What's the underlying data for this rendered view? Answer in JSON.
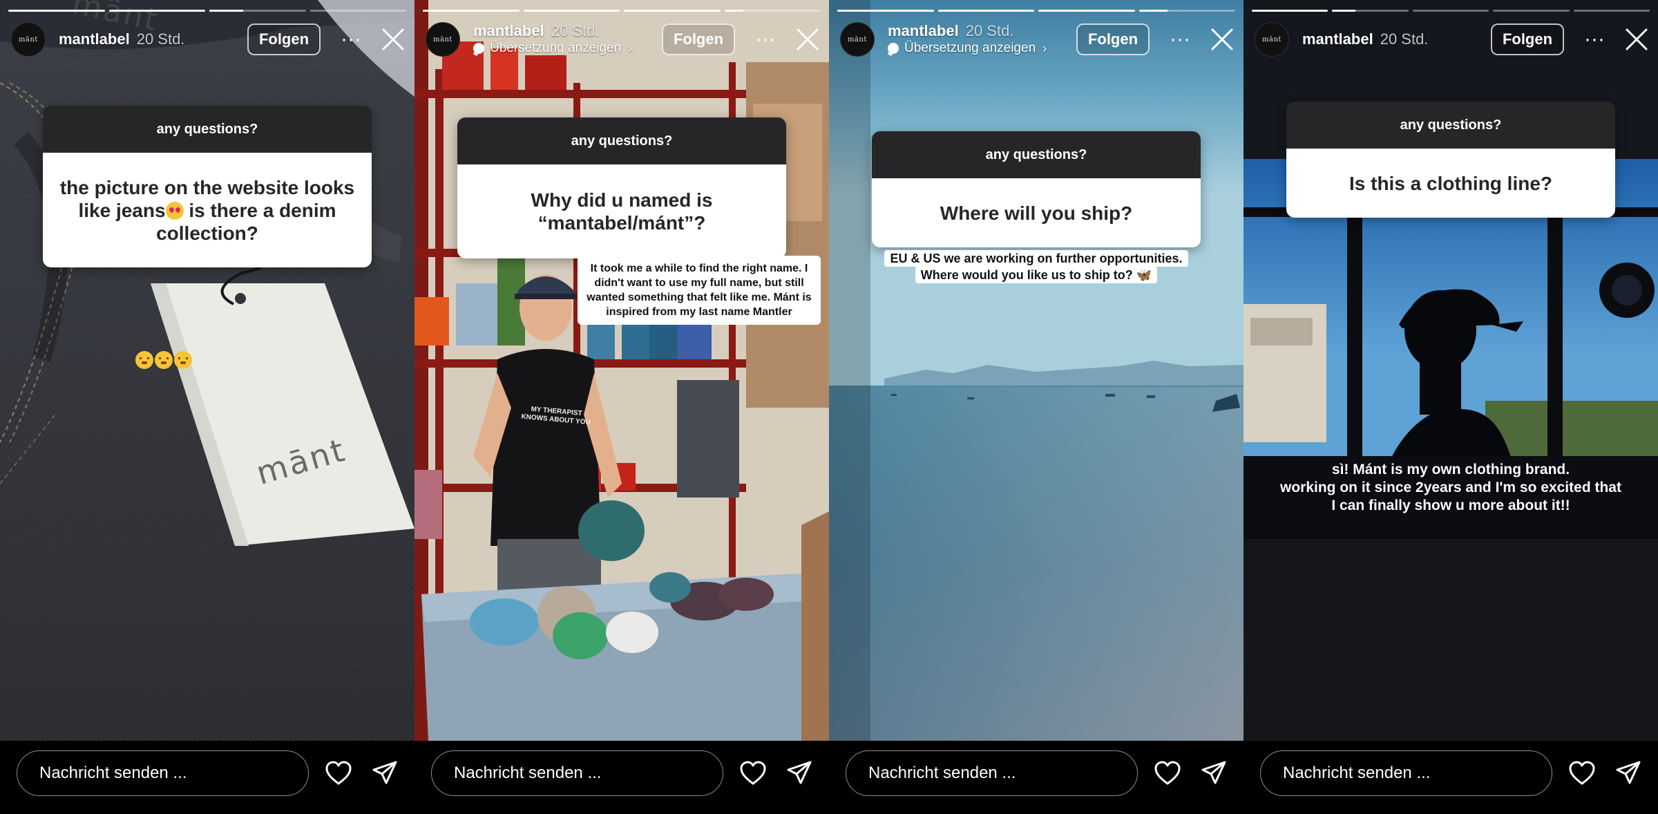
{
  "common": {
    "username": "mantlabel",
    "time": "20 Std.",
    "follow_label": "Folgen",
    "more_glyph": "···",
    "avatar_text": "mānt",
    "translate_label": "Übersetzung anzeigen",
    "message_placeholder": "Nachricht senden ...",
    "question_sticker_title": "any questions?",
    "icons": [
      "close-icon",
      "more-icon",
      "heart-icon",
      "send-icon",
      "translate-icon"
    ]
  },
  "stories": [
    {
      "progress": [
        1,
        1,
        0.35,
        0
      ],
      "show_translate": false,
      "question": "the picture on the website looks like jeans",
      "question_end": " is there a denim collection?",
      "tag_text": "mānt",
      "tag_top_text": "mänt"
    },
    {
      "progress": [
        1,
        1,
        1,
        0.2
      ],
      "show_translate": true,
      "question": "Why did u named is “mantabel/mánt”?",
      "answer": "It took me a while to find the right name. I didn't want to use my full name, but still wanted something that felt like me. Mánt is inspired from my last name Mantler",
      "shirt_text": "MY THERAPIST KNOWS ABOUT YOU"
    },
    {
      "progress": [
        1,
        1,
        1,
        0.3
      ],
      "show_translate": true,
      "question": "Where will you ship?",
      "answer_lines": [
        "EU & US we are working on further opportunities.",
        "Where would you like us to ship to? 🦋"
      ]
    },
    {
      "progress": [
        1,
        0.3,
        0,
        0,
        0
      ],
      "show_translate": false,
      "question": "Is this a clothing line?",
      "answer_lines": [
        "sì! Mánt is my own clothing brand.",
        "working on it since 2years and I'm so excited that",
        "I can finally show u more about it!!"
      ]
    }
  ],
  "colors": {
    "sticker_header": "#262628",
    "sticker_body": "#ffffff",
    "background": "#000000"
  }
}
